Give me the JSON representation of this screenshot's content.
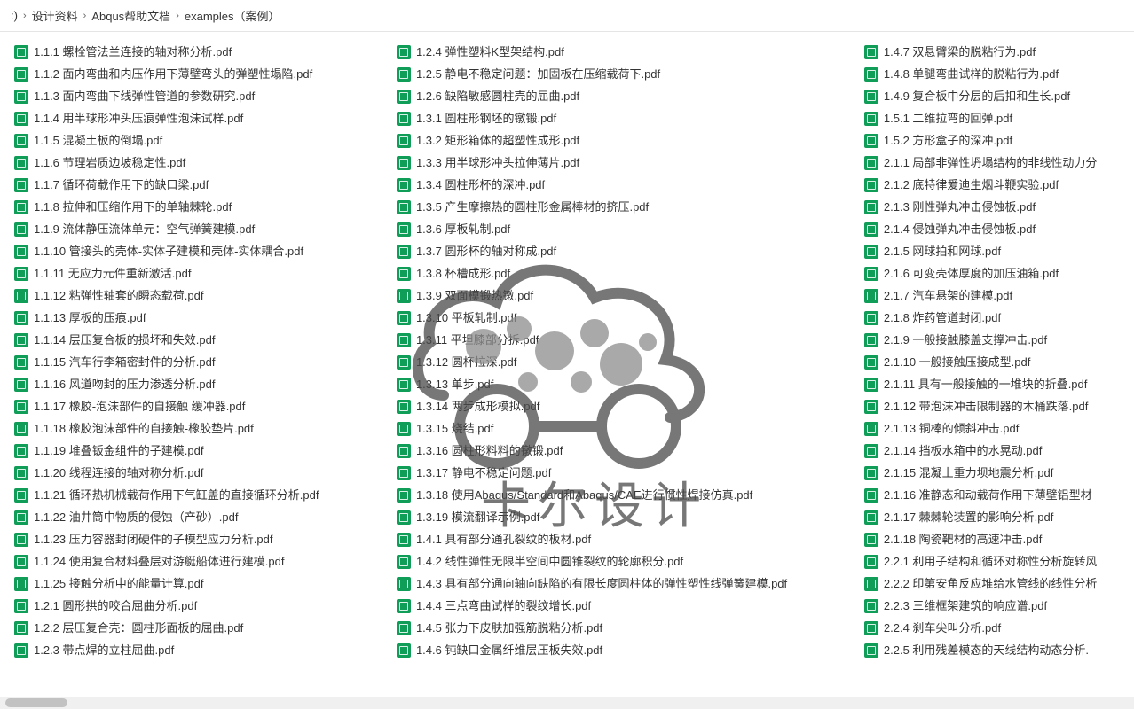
{
  "breadcrumb": [
    ":)",
    "设计资料",
    "Abqus帮助文档",
    "examples（案例）"
  ],
  "watermark_text": "卡尔设计",
  "columns": [
    [
      "1.1.1 螺栓管法兰连接的轴对称分析.pdf",
      "1.1.2 面内弯曲和内压作用下薄壁弯头的弹塑性塌陷.pdf",
      "1.1.3 面内弯曲下线弹性管道的参数研究.pdf",
      "1.1.4 用半球形冲头压痕弹性泡沫试样.pdf",
      "1.1.5 混凝土板的倒塌.pdf",
      "1.1.6 节理岩质边坡稳定性.pdf",
      "1.1.7 循环荷载作用下的缺口梁.pdf",
      "1.1.8 拉伸和压缩作用下的单轴棘轮.pdf",
      "1.1.9 流体静压流体单元：空气弹簧建模.pdf",
      "1.1.10 管接头的壳体-实体子建模和壳体-实体耦合.pdf",
      "1.1.11 无应力元件重新激活.pdf",
      "1.1.12 粘弹性轴套的瞬态载荷.pdf",
      "1.1.13 厚板的压痕.pdf",
      "1.1.14 层压复合板的损坏和失效.pdf",
      "1.1.15 汽车行李箱密封件的分析.pdf",
      "1.1.16 风道吻封的压力渗透分析.pdf",
      "1.1.17 橡胶-泡沫部件的自接触  缓冲器.pdf",
      "1.1.18 橡胶泡沫部件的自接触-橡胶垫片.pdf",
      "1.1.19 堆叠钣金组件的子建模.pdf",
      "1.1.20 线程连接的轴对称分析.pdf",
      "1.1.21 循环热机械载荷作用下气缸盖的直接循环分析.pdf",
      "1.1.22 油井筒中物质的侵蚀（产砂）.pdf",
      "1.1.23 压力容器封闭硬件的子模型应力分析.pdf",
      "1.1.24 使用复合材料叠层对游艇船体进行建模.pdf",
      "1.1.25 接触分析中的能量计算.pdf",
      "1.2.1 圆形拱的咬合屈曲分析.pdf",
      "1.2.2 层压复合壳：圆柱形面板的屈曲.pdf",
      "1.2.3 带点焊的立柱屈曲.pdf"
    ],
    [
      "1.2.4 弹性塑料K型架结构.pdf",
      "1.2.5 静电不稳定问题：加固板在压缩载荷下.pdf",
      "1.2.6 缺陷敏感圆柱壳的屈曲.pdf",
      "1.3.1 圆柱形钢坯的镦锻.pdf",
      "1.3.2 矩形箱体的超塑性成形.pdf",
      "1.3.3 用半球形冲头拉伸薄片.pdf",
      "1.3.4 圆柱形杯的深冲.pdf",
      "1.3.5 产生摩擦热的圆柱形金属棒材的挤压.pdf",
      "1.3.6 厚板轧制.pdf",
      "1.3.7 圆形杯的轴对称成.pdf",
      "1.3.8 杯槽成形.pdf",
      "1.3.9 双面模锻热镦.pdf",
      "1.3.10 平板轧制.pdf",
      "1.3.11 平坦膝部分拆.pdf",
      "1.3.12 圆杯拉深.pdf",
      "1.3.13 单步.pdf",
      "1.3.14 两步成形模拟.pdf",
      "1.3.15 烧结.pdf",
      "1.3.16 圆柱形料料的镦锻.pdf",
      "1.3.17 静电不稳定问题.pdf",
      "1.3.18 使用Abaqus/Standard和Abaqus/CAE进行惯性焊接仿真.pdf",
      "1.3.19 模流翻译示例.pdf",
      "1.4.1 具有部分通孔裂纹的板材.pdf",
      "1.4.2 线性弹性无限半空间中圆锥裂纹的轮廓积分.pdf",
      "1.4.3 具有部分通向轴向缺陷的有限长度圆柱体的弹性塑性线弹簧建模.pdf",
      "1.4.4 三点弯曲试样的裂纹增长.pdf",
      "1.4.5 张力下皮肤加强筋脱粘分析.pdf",
      "1.4.6 钝缺口金属纤维层压板失效.pdf"
    ],
    [
      "1.4.7 双悬臂梁的脱粘行为.pdf",
      "1.4.8 单腿弯曲试样的脱粘行为.pdf",
      "1.4.9 复合板中分层的后扣和生长.pdf",
      "1.5.1 二维拉弯的回弹.pdf",
      "1.5.2 方形盒子的深冲.pdf",
      "2.1.1 局部非弹性坍塌结构的非线性动力分",
      "2.1.2 底特律爱迪生烟斗鞭实验.pdf",
      "2.1.3 刚性弹丸冲击侵蚀板.pdf",
      "2.1.4 侵蚀弹丸冲击侵蚀板.pdf",
      "2.1.5 网球拍和网球.pdf",
      "2.1.6 可变壳体厚度的加压油箱.pdf",
      "2.1.7 汽车悬架的建模.pdf",
      "2.1.8 炸药管道封闭.pdf",
      "2.1.9 一般接触膝盖支撑冲击.pdf",
      "2.1.10 一般接触压接成型.pdf",
      "2.1.11 具有一般接触的一堆块的折叠.pdf",
      "2.1.12 带泡沫冲击限制器的木桶跌落.pdf",
      "2.1.13 铜棒的倾斜冲击.pdf",
      "2.1.14 挡板水箱中的水晃动.pdf",
      "2.1.15 混凝土重力坝地震分析.pdf",
      "2.1.16 准静态和动载荷作用下薄壁铝型材",
      "2.1.17 棘棘轮装置的影响分析.pdf",
      "2.1.18 陶瓷靶材的高速冲击.pdf",
      "2.2.1 利用子结构和循环对称性分析旋转风",
      "2.2.2 印第安角反应堆给水管线的线性分析",
      "2.2.3 三维框架建筑的响应谱.pdf",
      "2.2.4 刹车尖叫分析.pdf",
      "2.2.5 利用残差模态的天线结构动态分析."
    ]
  ]
}
